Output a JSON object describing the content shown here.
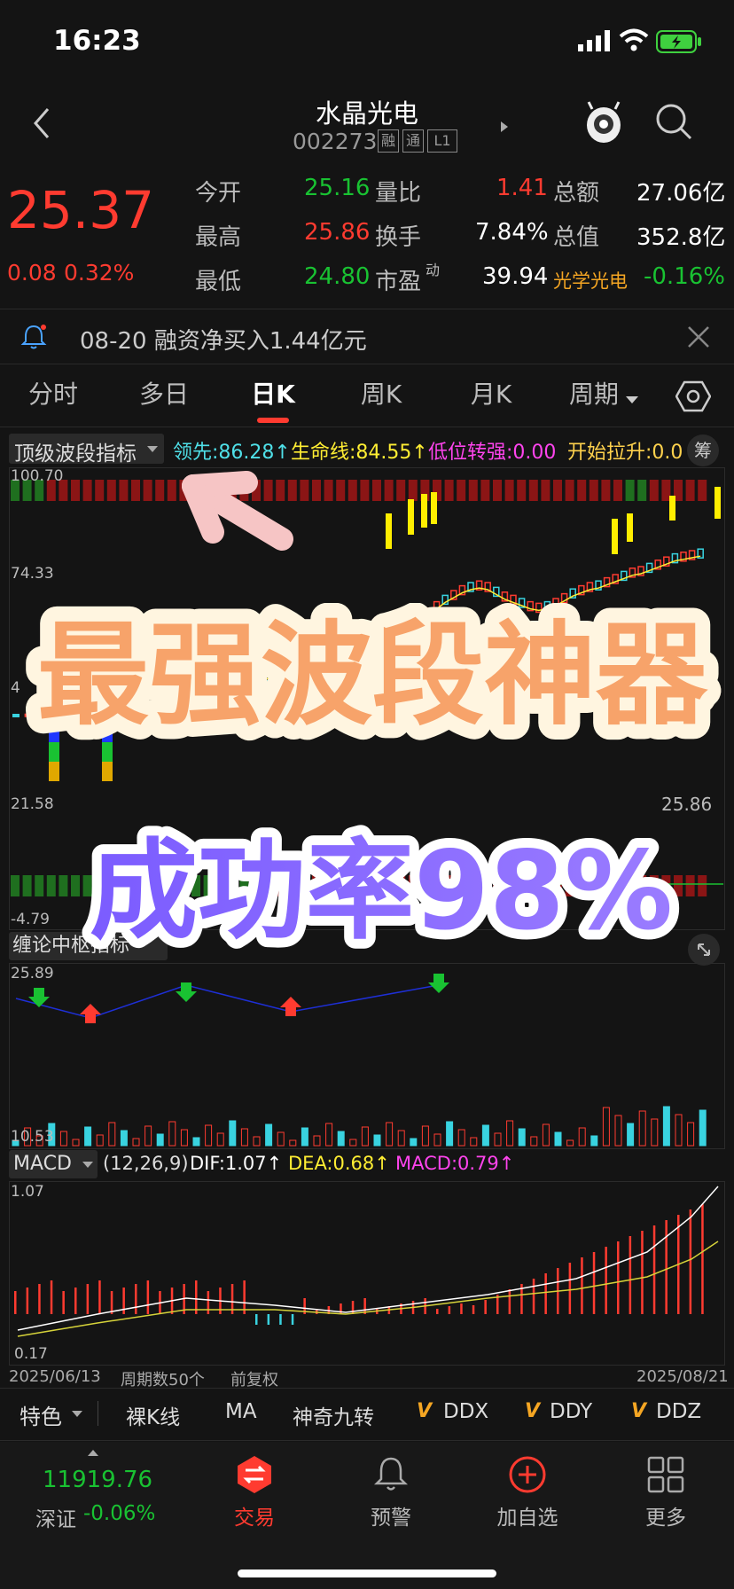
{
  "status": {
    "time": "16:23"
  },
  "header": {
    "title": "水晶光电",
    "code": "002273",
    "badges": [
      "融",
      "通",
      "L1"
    ]
  },
  "quote": {
    "price": "25.37",
    "change": "0.08",
    "change_pct": "0.32%",
    "rows": [
      [
        {
          "label": "今开",
          "value": "25.16",
          "color": "green"
        },
        {
          "label": "量比",
          "value": "1.41",
          "color": "red"
        },
        {
          "label": "总额",
          "value": "27.06亿",
          "color": "white"
        }
      ],
      [
        {
          "label": "最高",
          "value": "25.86",
          "color": "red"
        },
        {
          "label": "换手",
          "value": "7.84%",
          "color": "white"
        },
        {
          "label": "总值",
          "value": "352.8亿",
          "color": "white"
        }
      ],
      [
        {
          "label": "最低",
          "value": "24.80",
          "color": "green"
        },
        {
          "label": "市盈",
          "sup": "动",
          "value": "39.94",
          "color": "white"
        },
        {
          "label": "光学光电",
          "value": "-0.16%",
          "color": "green"
        }
      ]
    ]
  },
  "notice": {
    "text": "08-20 融资净买入1.44亿元"
  },
  "tabs": [
    "分时",
    "多日",
    "日K",
    "周K",
    "月K",
    "周期"
  ],
  "indicator1": {
    "name": "顶级波段指标",
    "items": [
      "领先:86.28↑",
      "生命线:84.55↑",
      "低位转强:0.00",
      "开始拉升:0.0"
    ],
    "right_label": "筹",
    "ticks": [
      "100.70",
      "74.33",
      "4",
      "21.58",
      "-4.79"
    ],
    "last_price": "25.86"
  },
  "indicator2": {
    "name": "缠论中枢指标",
    "ticks": [
      "25.89",
      "10.53"
    ]
  },
  "macd": {
    "name": "MACD",
    "params": "(12,26,9)",
    "dif": "DIF:1.07↑",
    "dea": "DEA:0.68↑",
    "macd": "MACD:0.79↑",
    "ticks": [
      "1.07",
      "0.17"
    ],
    "foot_left": "2025/06/13",
    "foot_mid1": "周期数50个",
    "foot_mid2": "前复权",
    "foot_right": "2025/08/21"
  },
  "bottom_indicators": {
    "special": "特色",
    "items": [
      "裸K线",
      "MA",
      "神奇九转"
    ],
    "v_items": [
      "DDX",
      "DDY",
      "DDZ"
    ]
  },
  "nav": {
    "index_value": "11919.76",
    "index_name": "深证",
    "index_change": "-0.06%",
    "items": [
      "交易",
      "预警",
      "加自选",
      "更多"
    ]
  },
  "overlay": {
    "line1": "最强波段神器",
    "line2": "成功率98%"
  },
  "colors": {
    "up": "#ff3b30",
    "down": "#19c232",
    "accent": "#ff3b30"
  }
}
